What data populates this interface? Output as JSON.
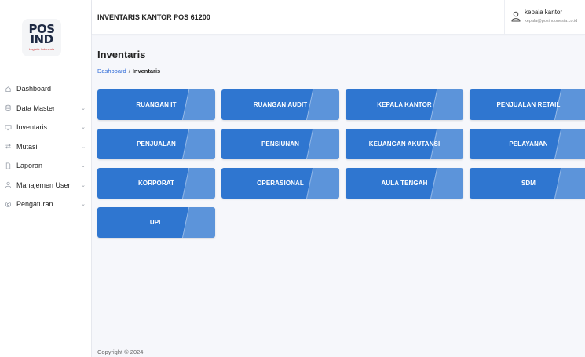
{
  "logo": {
    "line1": "POS",
    "line2": "IND",
    "tagline": "Logistik Indonesia"
  },
  "app": {
    "title": "INVENTARIS KANTOR POS 61200"
  },
  "user": {
    "name": "kepala kantor",
    "email": "kepala@posindonesia.co.id"
  },
  "sidebar": {
    "items": [
      {
        "label": "Dashboard",
        "icon": "home-icon",
        "chevron": ""
      },
      {
        "label": "Data Master",
        "icon": "database-icon",
        "chevron": "⌄"
      },
      {
        "label": "Inventaris",
        "icon": "monitor-icon",
        "chevron": "⌄"
      },
      {
        "label": "Mutasi",
        "icon": "transfer-icon",
        "chevron": "⌄"
      },
      {
        "label": "Laporan",
        "icon": "document-icon",
        "chevron": "⌄"
      },
      {
        "label": "Manajemen User",
        "icon": "user-icon",
        "chevron": "⌄"
      },
      {
        "label": "Pengaturan",
        "icon": "gear-icon",
        "chevron": "⌄"
      }
    ]
  },
  "page": {
    "title": "Inventaris"
  },
  "breadcrumb": {
    "home": "Dashboard",
    "separator": "/",
    "current": "Inventaris"
  },
  "tiles": [
    "RUANGAN IT",
    "RUANGAN AUDIT",
    "KEPALA KANTOR",
    "PENJUALAN RETAIL",
    "PENJUALAN",
    "PENSIUNAN",
    "KEUANGAN AKUTANSI",
    "PELAYANAN",
    "KORPORAT",
    "OPERASIONAL",
    "AULA TENGAH",
    "SDM",
    "UPL"
  ],
  "footer": {
    "copyright": "Copyright © 2024"
  },
  "colors": {
    "tile": "#2f76d0",
    "link": "#2f6bd8",
    "background": "#f6f7fb"
  }
}
